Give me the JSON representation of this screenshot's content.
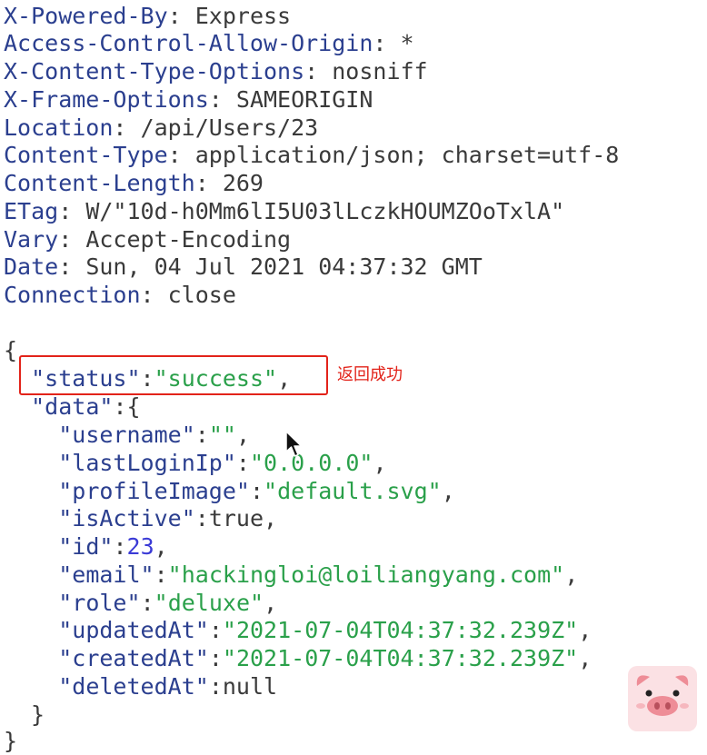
{
  "headers": [
    {
      "name": "X-Powered-By",
      "value": "Express"
    },
    {
      "name": "Access-Control-Allow-Origin",
      "value": "*"
    },
    {
      "name": "X-Content-Type-Options",
      "value": "nosniff"
    },
    {
      "name": "X-Frame-Options",
      "value": "SAMEORIGIN"
    },
    {
      "name": "Location",
      "value": "/api/Users/23"
    },
    {
      "name": "Content-Type",
      "value": "application/json; charset=utf-8"
    },
    {
      "name": "Content-Length",
      "value": "269"
    },
    {
      "name": "ETag",
      "value": "W/\"10d-h0Mm6lI5U03lLczkHOUMZOoTxlA\""
    },
    {
      "name": "Vary",
      "value": "Accept-Encoding"
    },
    {
      "name": "Date",
      "value": "Sun, 04 Jul 2021 04:37:32 GMT"
    },
    {
      "name": "Connection",
      "value": "close"
    }
  ],
  "body": {
    "open_brace": "{",
    "close_brace": "}",
    "inner_close": "}",
    "status": {
      "key": "status",
      "value": "success"
    },
    "data_key": "data",
    "fields": [
      {
        "key": "username",
        "value": ""
      },
      {
        "key": "lastLoginIp",
        "value": "0.0.0.0"
      },
      {
        "key": "profileImage",
        "value": "default.svg"
      },
      {
        "key": "isActive",
        "value": "true"
      },
      {
        "key": "id",
        "value": "23"
      },
      {
        "key": "email",
        "value": "hackingloi@loiliangyang.com"
      },
      {
        "key": "role",
        "value": "deluxe"
      },
      {
        "key": "updatedAt",
        "value": "2021-07-04T04:37:32.239Z"
      },
      {
        "key": "createdAt",
        "value": "2021-07-04T04:37:32.239Z"
      },
      {
        "key": "deletedAt",
        "value": "null"
      }
    ]
  },
  "annotation": {
    "label": "返回成功",
    "color": "#e2231a"
  },
  "colors": {
    "header_key": "#2b3f8f",
    "string": "#2aa04a",
    "number": "#3b3bd6",
    "text": "#3a3a3a"
  },
  "icons": {
    "cursor": "mouse-cursor-icon",
    "mascot": "pig-mascot-icon"
  }
}
